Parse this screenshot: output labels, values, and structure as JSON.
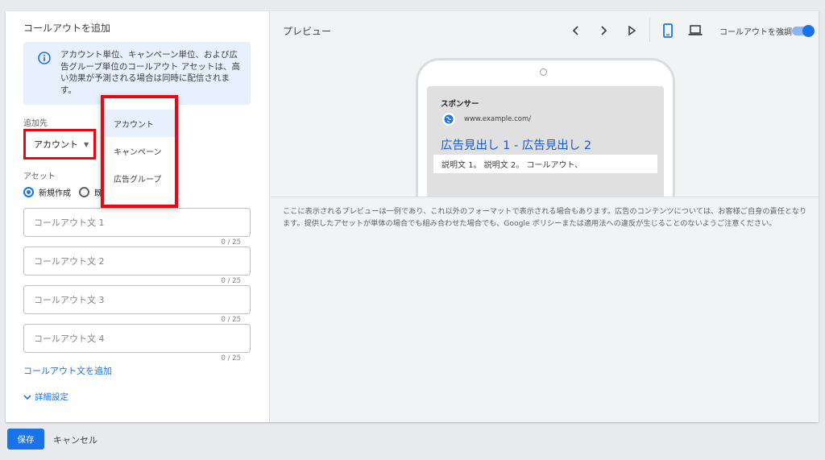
{
  "form": {
    "section_title": "コールアウトを追加",
    "info_icon": "info-icon",
    "info_text": "アカウント単位、キャンペーン単位、および広告グループ単位のコールアウト アセットは、高い効果が予測される場合は同時に配信されます。",
    "add_to_label": "追加先",
    "add_to_value": "アカウント",
    "dropdown_options": [
      "アカウント",
      "キャンペーン",
      "広告グループ"
    ],
    "asset_label": "アセット",
    "radio_new": "新規作成",
    "radio_existing": "既",
    "fields": [
      {
        "placeholder": "コールアウト文 1",
        "counter": "0 / 25"
      },
      {
        "placeholder": "コールアウト文 2",
        "counter": "0 / 25"
      },
      {
        "placeholder": "コールアウト文 3",
        "counter": "0 / 25"
      },
      {
        "placeholder": "コールアウト文 4",
        "counter": "0 / 25"
      }
    ],
    "add_link": "コールアウト文を追加",
    "advanced": "詳細設定"
  },
  "preview": {
    "title": "プレビュー",
    "toggle_label": "コールアウトを強調",
    "toggle_on": true,
    "ad": {
      "sponsor": "スポンサー",
      "url": "www.example.com/",
      "headline": "広告見出し 1 - 広告見出し 2",
      "description": "説明文 1。 説明文 2。 コールアウト、"
    },
    "notice": "ここに表示されるプレビューは一例であり、これ以外のフォーマットで表示される場合もあります。広告のコンテンツについては、お客様ご自身の責任となります。提供したアセットが単体の場合でも組み合わせた場合でも、Google ポリシーまたは適用法への違反が生じることのないようご注意ください。"
  },
  "footer": {
    "save": "保存",
    "cancel": "キャンセル"
  },
  "colors": {
    "accent": "#1a73e8",
    "highlight_border": "#e50914",
    "info_bg": "#e8f0fe"
  }
}
